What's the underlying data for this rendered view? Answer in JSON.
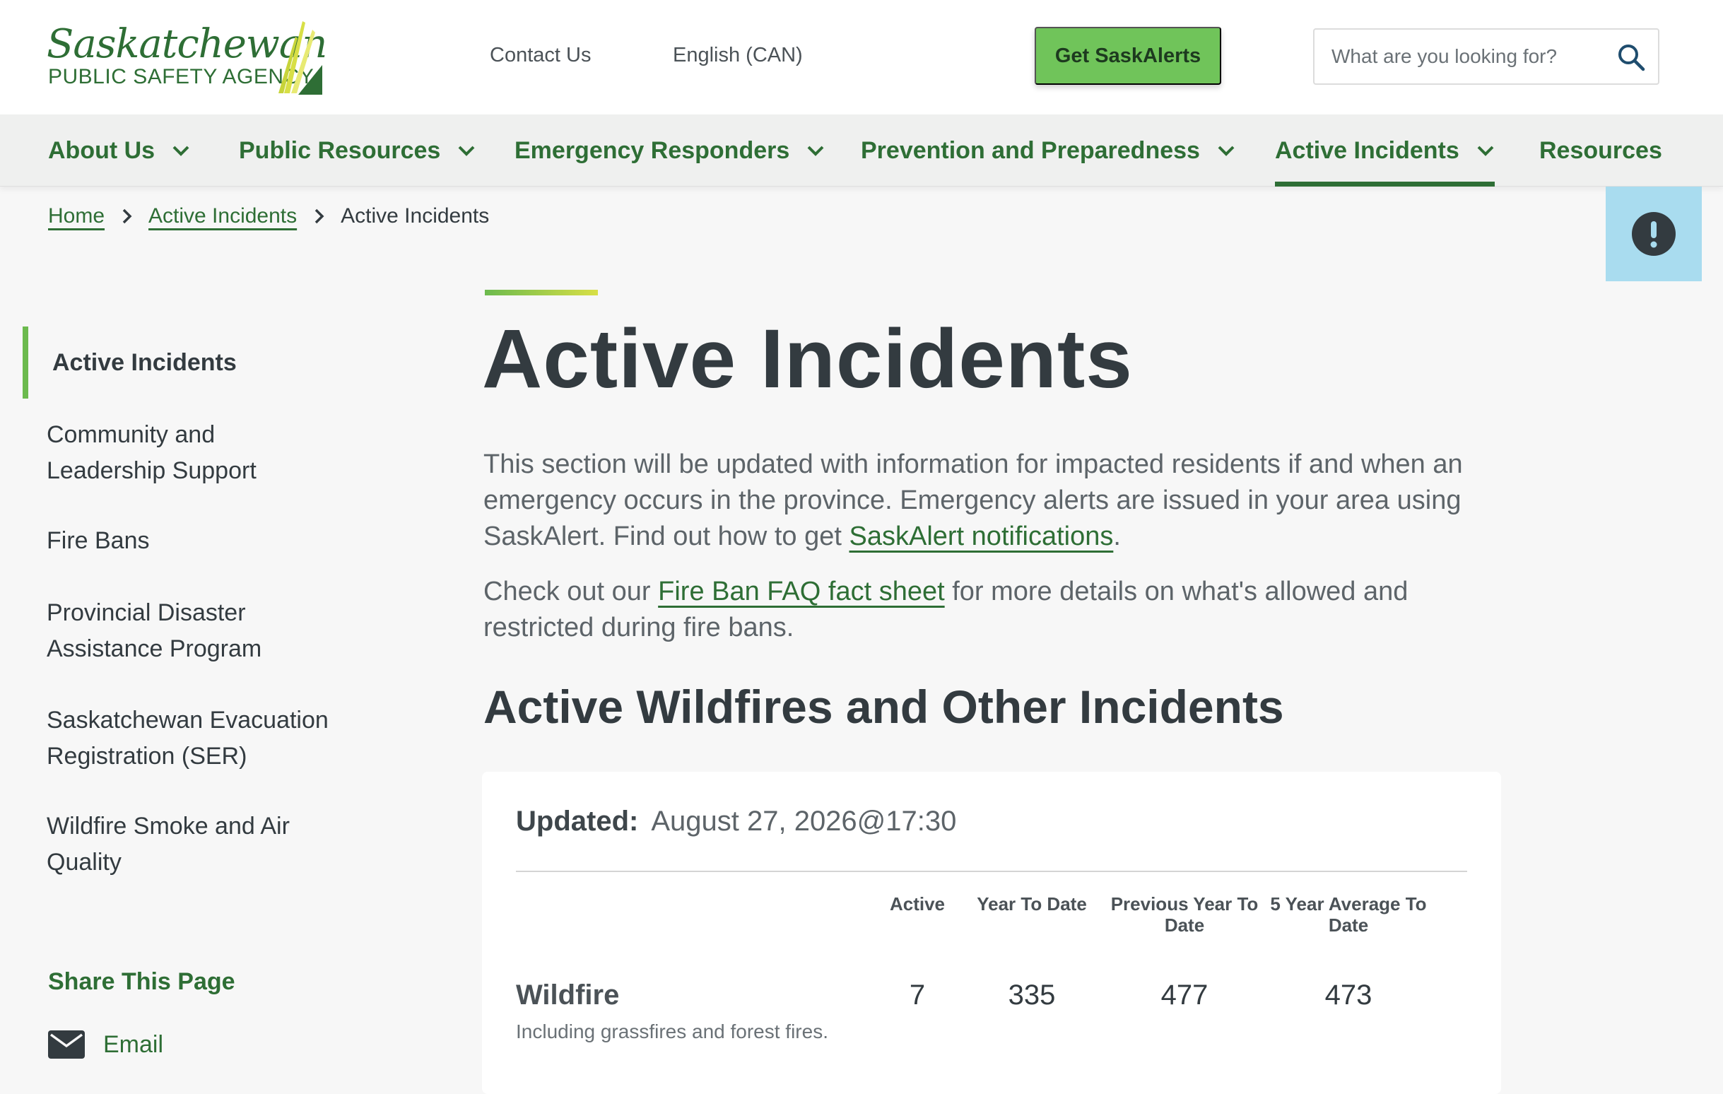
{
  "header": {
    "logo_title": "Saskatchewan",
    "logo_subtitle": "PUBLIC SAFETY AGENCY",
    "contact_label": "Contact Us",
    "language_label": "English (CAN)",
    "alerts_button_label": "Get SaskAlerts",
    "search_placeholder": "What are you looking for?",
    "search_value": ""
  },
  "nav": {
    "items": [
      {
        "label": "About Us",
        "has_dropdown": true,
        "active": false
      },
      {
        "label": "Public Resources",
        "has_dropdown": true,
        "active": false
      },
      {
        "label": "Emergency Responders",
        "has_dropdown": true,
        "active": false
      },
      {
        "label": "Prevention and Preparedness",
        "has_dropdown": true,
        "active": false
      },
      {
        "label": "Active Incidents",
        "has_dropdown": true,
        "active": true
      },
      {
        "label": "Resources",
        "has_dropdown": false,
        "active": false
      }
    ]
  },
  "breadcrumb": {
    "home": "Home",
    "parent": "Active Incidents",
    "current": "Active Incidents"
  },
  "alert_tab": {
    "icon": "exclamation-circle-icon"
  },
  "sidebar": {
    "items": [
      {
        "label": "Active Incidents",
        "active": true
      },
      {
        "label": "Community and Leadership Support",
        "active": false
      },
      {
        "label": "Fire Bans",
        "active": false
      },
      {
        "label": "Provincial Disaster Assistance Program",
        "active": false
      },
      {
        "label": "Saskatchewan Evacuation Registration (SER)",
        "active": false
      },
      {
        "label": "Wildfire Smoke and Air Quality",
        "active": false
      }
    ],
    "share_title": "Share This Page",
    "share_email_label": "Email"
  },
  "main": {
    "title": "Active Incidents",
    "intro_1_text": "This section will be updated with information for impacted residents if and when an emergency occurs in the province. Emergency alerts are issued in your area using SaskAlert. Find out how to get ",
    "intro_1_link": "SaskAlert notifications",
    "intro_1_end": ".",
    "intro_2_start": "Check out our ",
    "intro_2_link": "Fire Ban FAQ fact sheet",
    "intro_2_end": " for more details on what's allowed and restricted during fire bans.",
    "section_title": "Active Wildfires and Other Incidents"
  },
  "incidents": {
    "updated_label": "Updated:",
    "updated_value": "August 27, 2026@17:30",
    "columns": [
      "Active",
      "Year To Date",
      "Previous Year To Date",
      "5 Year Average To Date"
    ],
    "rows": [
      {
        "name": "Wildfire",
        "description": "Including grassfires and forest fires.",
        "values": [
          "7",
          "335",
          "477",
          "473"
        ]
      }
    ]
  },
  "colors": {
    "brand_green": "#2e6e35",
    "button_green": "#70c45a",
    "accent_green": "#6cba4e",
    "alert_blue": "#a9dcef",
    "text_dark": "#333b40"
  }
}
